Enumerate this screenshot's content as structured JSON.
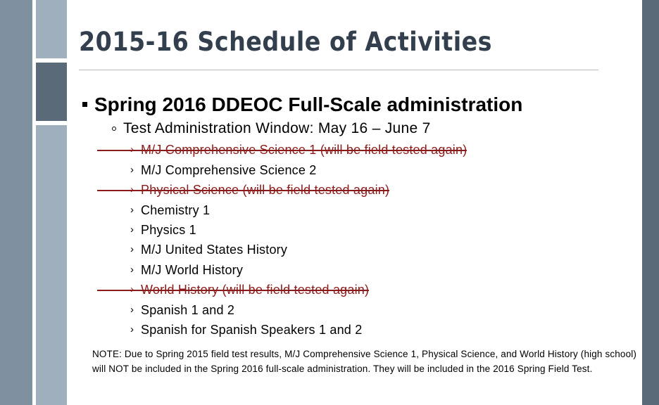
{
  "slide": {
    "title": "2015-16   Schedule of Activities",
    "main_bullet": "Spring 2016 DDEOC Full-Scale administration",
    "sub_bullet": "Test Administration Window:  May 16 – June 7",
    "courses": [
      {
        "label": "M/J Comprehensive Science 1 (will be field tested again)",
        "struck": true
      },
      {
        "label": "M/J Comprehensive Science 2",
        "struck": false
      },
      {
        "label": "Physical Science (will be field tested again)",
        "struck": true
      },
      {
        "label": "Chemistry 1",
        "struck": false
      },
      {
        "label": "Physics 1",
        "struck": false
      },
      {
        "label": "M/J United States History",
        "struck": false
      },
      {
        "label": "M/J World History",
        "struck": false
      },
      {
        "label": "World History (will be field tested again)",
        "struck": true
      },
      {
        "label": "Spanish 1 and 2",
        "struck": false
      },
      {
        "label": "Spanish for Spanish Speakers 1 and 2",
        "struck": false
      }
    ],
    "note": "NOTE: Due to Spring 2015 field test results, M/J Comprehensive Science 1, Physical Science, and World History (high school) will NOT be included in the Spring 2016 full-scale administration. They will be included in the 2016 Spring Field Test.",
    "chevron_glyph": "›",
    "colors": {
      "title_text": "#333f4d",
      "sidebar_main": "#7f90a1",
      "sidebar_light": "#9fafbd",
      "sidebar_dark": "#5b6a78",
      "right_bar": "#5b6a78",
      "struck_text": "#8b1a1a",
      "rule": "#b6bcc2"
    }
  }
}
